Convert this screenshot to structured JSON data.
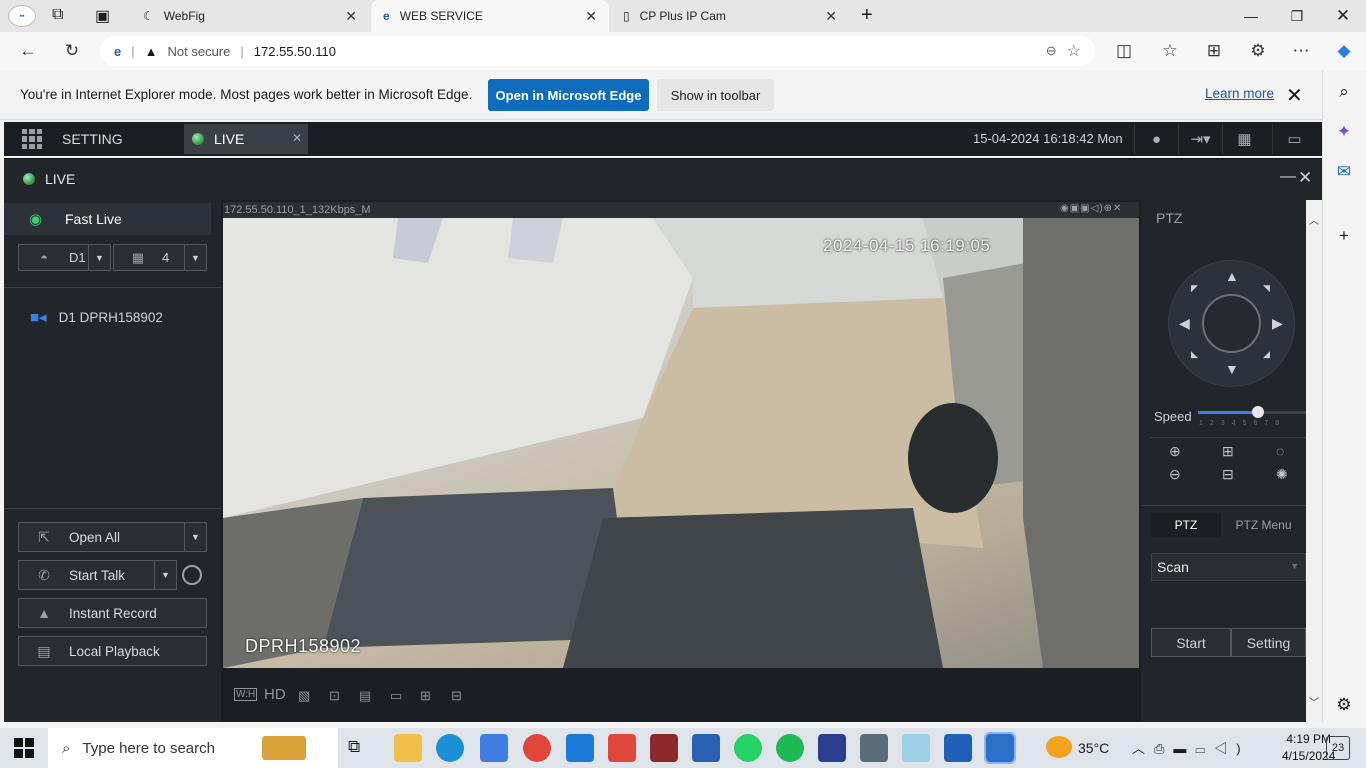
{
  "browser": {
    "tabs": [
      {
        "label": "WebFig",
        "active": false
      },
      {
        "label": "WEB SERVICE",
        "active": true
      },
      {
        "label": "CP Plus IP Cam",
        "active": false
      }
    ],
    "security_label": "Not secure",
    "url": "172.55.50.110"
  },
  "ie_banner": {
    "message": "You're in Internet Explorer mode. Most pages work better in Microsoft Edge.",
    "open_edge_label": "Open in Microsoft Edge",
    "show_toolbar_label": "Show in toolbar",
    "learn_more_label": "Learn more"
  },
  "app": {
    "setting_label": "SETTING",
    "live_tab_label": "LIVE",
    "datetime": "15-04-2024 16:18:42 Mon",
    "live_header": "LIVE",
    "fast_live_label": "Fast Live",
    "channel_value": "D1",
    "layout_value": "4",
    "device_item": "D1 DPRH158902",
    "buttons": {
      "open_all": "Open All",
      "start_talk": "Start Talk",
      "instant_record": "Instant Record",
      "local_playback": "Local Playback"
    },
    "video_title": "172.55.50.110_1_132Kbps_M",
    "osd_time": "2024-04-15 16:19:05",
    "osd_name": "DPRH158902",
    "video_toolbar": {
      "wh": "W:H",
      "hd": "HD"
    },
    "ptz": {
      "title": "PTZ",
      "speed_label": "Speed",
      "speed_value": 5,
      "speed_ticks": "12345678",
      "tab_ptz": "PTZ",
      "tab_menu": "PTZ Menu",
      "mode_value": "Scan",
      "start_label": "Start",
      "setting_label": "Setting"
    }
  },
  "taskbar": {
    "search_placeholder": "Type here to search",
    "temperature": "35°C",
    "time": "4:19 PM",
    "date": "4/15/2024",
    "notification_count": "23"
  }
}
